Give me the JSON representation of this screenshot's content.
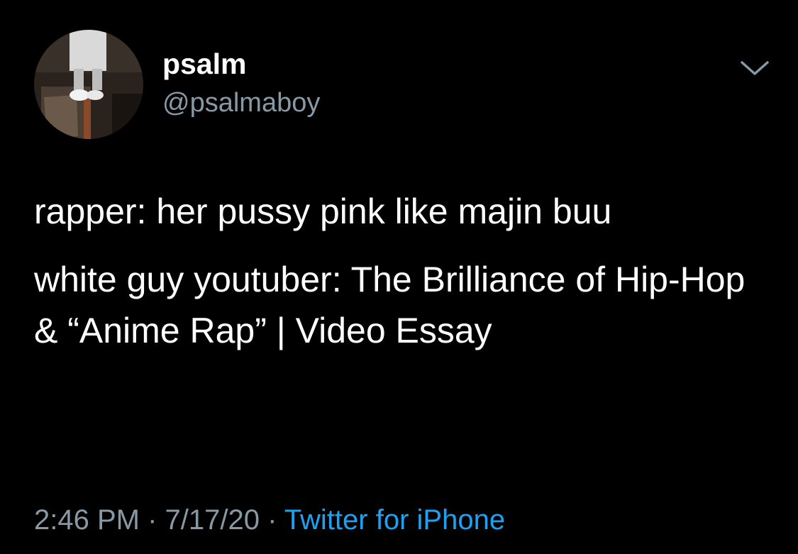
{
  "user": {
    "display_name": "psalm",
    "handle": "@psalmaboy"
  },
  "tweet": {
    "paragraphs": [
      "rapper: her pussy pink like majin buu",
      "white guy youtuber: The Brilliance of Hip-Hop & “Anime Rap” | Video Essay"
    ]
  },
  "meta": {
    "time": "2:46 PM",
    "separator": " · ",
    "date": "7/17/20",
    "source": "Twitter for iPhone"
  },
  "icons": {
    "menu": "chevron-down-icon"
  },
  "colors": {
    "background": "#000000",
    "text": "#ffffff",
    "secondary": "#8899a6",
    "link": "#1da1f2"
  }
}
